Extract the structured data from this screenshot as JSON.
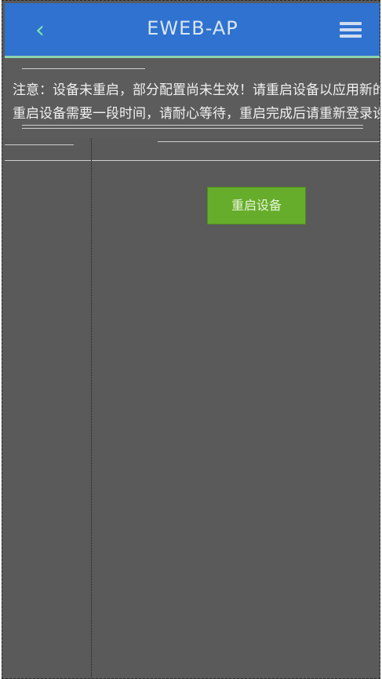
{
  "header": {
    "title": "EWEB-AP",
    "back_icon": "chevron-left-icon",
    "menu_icon": "hamburger-menu-icon"
  },
  "notice": {
    "line1": "注意：设备未重启，部分配置尚未生效！请重启设备以应用新的配置",
    "line2": "重启设备需要一段时间，请耐心等待，重启完成后请重新登录设备。"
  },
  "actions": {
    "restart_label": "重启设备"
  },
  "colors": {
    "header_bg": "#2f72cf",
    "accent_green": "#66ad2b",
    "content_bg": "#5a5a5a"
  }
}
